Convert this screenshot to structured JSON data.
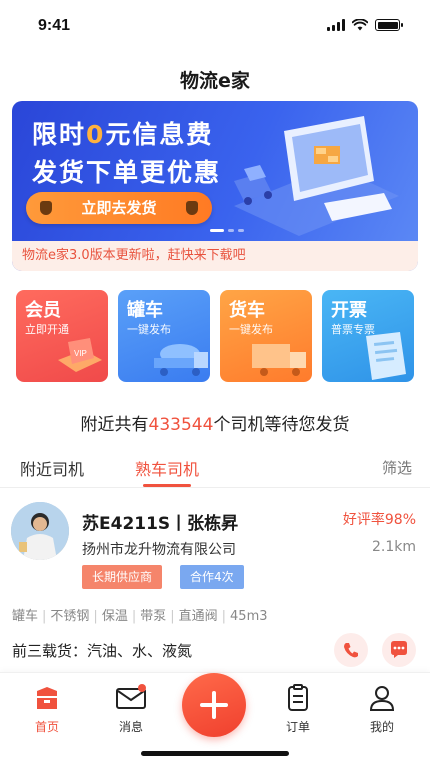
{
  "status_bar": {
    "time": "9:41"
  },
  "app": {
    "title": "物流e家"
  },
  "banner": {
    "headline1_prefix": "限时",
    "headline1_zero": "0",
    "headline1_suffix": "元信息费",
    "headline2": "发货下单更优惠",
    "cta_label": "立即去发货",
    "ticker": "物流e家3.0版本更新啦，赶快来下载吧",
    "colors": {
      "primary": "#3a63ee",
      "accent": "#ff7a23",
      "highlight": "#ffb23e"
    }
  },
  "quick_actions": [
    {
      "title": "会员",
      "subtitle": "立即开通",
      "icon": "vip-card-icon"
    },
    {
      "title": "罐车",
      "subtitle": "一键发布",
      "icon": "tanker-truck-icon"
    },
    {
      "title": "货车",
      "subtitle": "一键发布",
      "icon": "cargo-truck-icon"
    },
    {
      "title": "开票",
      "subtitle": "普票专票",
      "icon": "invoice-icon"
    }
  ],
  "nearby": {
    "prefix": "附近共有",
    "count": "433544",
    "suffix": "个司机等待您发货"
  },
  "tabs": [
    {
      "label": "附近司机"
    },
    {
      "label": "熟车司机",
      "active": true
    }
  ],
  "filter_label": "筛选",
  "driver": {
    "plate_name": "苏E4211S丨张栋昇",
    "rating": "好评率98%",
    "company": "扬州市龙升物流有限公司",
    "distance": "2.1km",
    "badges": [
      "长期供应商",
      "合作4次"
    ],
    "specs": [
      "罐车",
      "不锈钢",
      "保温",
      "带泵",
      "直通阀",
      "45m3"
    ],
    "cargo": "前三载货：汽油、水、液氮"
  },
  "bottom_nav": [
    {
      "label": "首页",
      "icon": "home-icon",
      "active": true
    },
    {
      "label": "消息",
      "icon": "mail-icon"
    },
    {
      "label": "订单",
      "icon": "clipboard-icon"
    },
    {
      "label": "我的",
      "icon": "person-icon"
    }
  ],
  "theme": {
    "brand_red": "#f0523e",
    "tab_inactive": "#333333"
  }
}
